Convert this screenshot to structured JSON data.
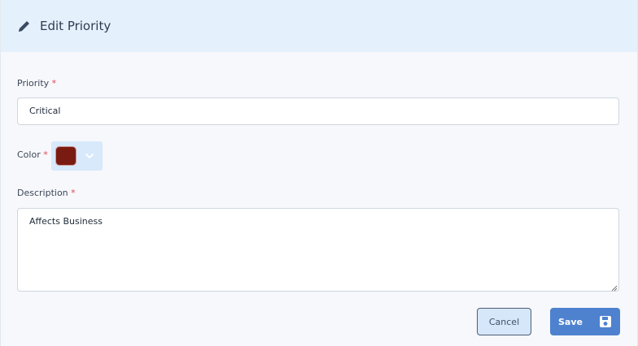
{
  "dialog": {
    "title": "Edit Priority",
    "icons": {
      "header": "pencil-icon",
      "color_dropdown": "chevron-down-icon",
      "save": "save-icon"
    }
  },
  "form": {
    "priority": {
      "label": "Priority",
      "required_mark": "*",
      "value": "Critical"
    },
    "color": {
      "label": "Color",
      "required_mark": "*",
      "value": "#7a1b12"
    },
    "description": {
      "label": "Description",
      "required_mark": "*",
      "value": "Affects Business"
    }
  },
  "actions": {
    "cancel_label": "Cancel",
    "save_label": "Save"
  },
  "colors": {
    "header_bg": "#e4f1fc",
    "save_bg": "#4e82cf",
    "required": "#e0485a"
  }
}
